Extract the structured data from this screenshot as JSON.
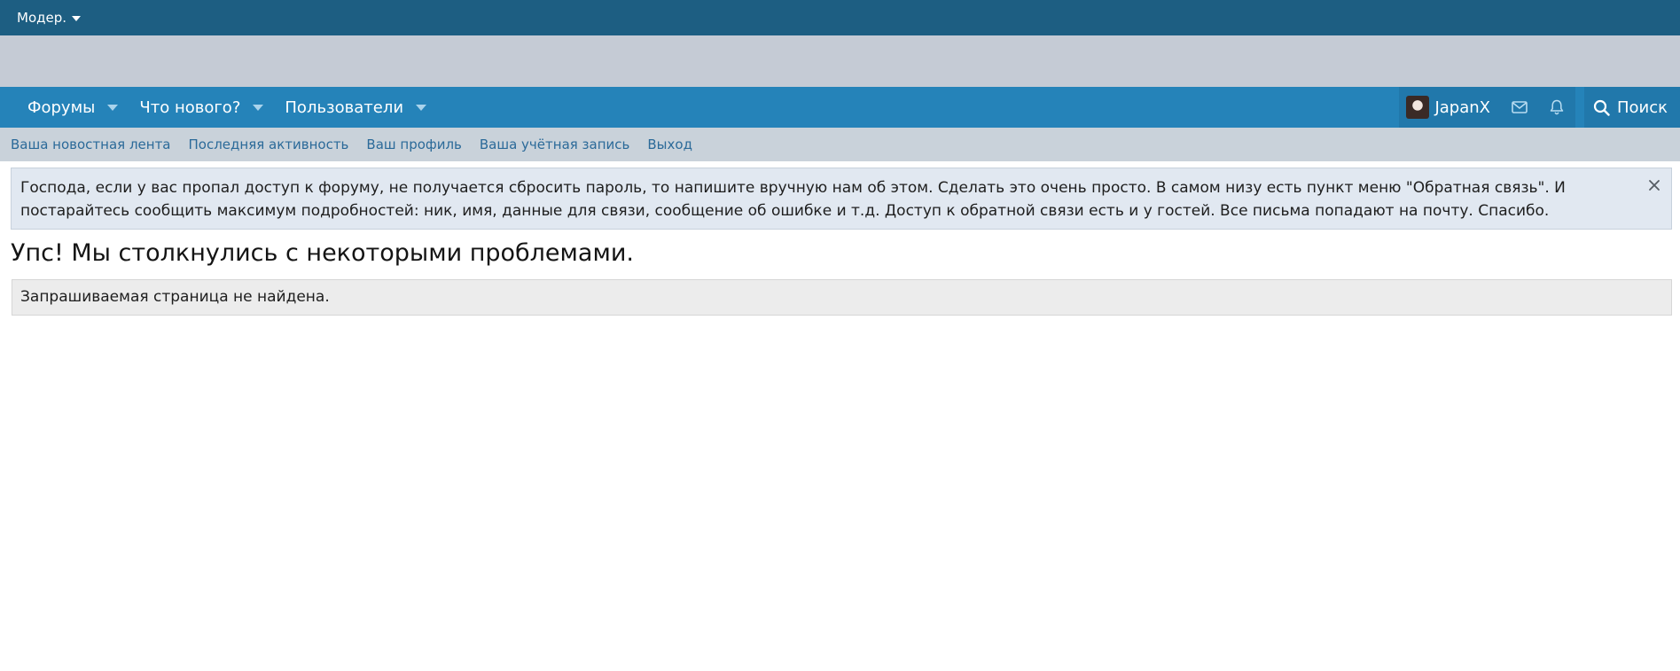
{
  "staff_bar": {
    "moderator_label": "Модер."
  },
  "nav": {
    "tabs": [
      {
        "label": "Форумы"
      },
      {
        "label": "Что нового?"
      },
      {
        "label": "Пользователи"
      }
    ],
    "username": "JapanX",
    "search_label": "Поиск"
  },
  "sub_nav": {
    "links": [
      {
        "label": "Ваша новостная лента"
      },
      {
        "label": "Последняя активность"
      },
      {
        "label": "Ваш профиль"
      },
      {
        "label": "Ваша учётная запись"
      },
      {
        "label": "Выход"
      }
    ]
  },
  "notice": {
    "text": "Господа, если у вас пропал доступ к форуму, не получается сбросить пароль, то напишите вручную нам об этом. Сделать это очень просто. В самом низу есть пункт меню \"Обратная связь\". И постарайтесь сообщить максимум подробностей: ник, имя, данные для связи, сообщение об ошибке и т.д. Доступ к обратной связи есть и у гостей. Все письма попадают на почту. Спасибо."
  },
  "error": {
    "title": "Упс! Мы столкнулись с некоторыми проблемами.",
    "message": "Запрашиваемая страница не найдена."
  },
  "colors": {
    "staff_bar": "#1d5e82",
    "header_band": "#c5cbd5",
    "main_nav": "#2583b9",
    "sub_nav": "#c9d2da",
    "link": "#2b6a99",
    "notice_bg": "#e1e8f1",
    "error_bg": "#ececec"
  },
  "icons": [
    "caret-down-icon",
    "envelope-icon",
    "bell-icon",
    "search-icon",
    "close-icon"
  ]
}
